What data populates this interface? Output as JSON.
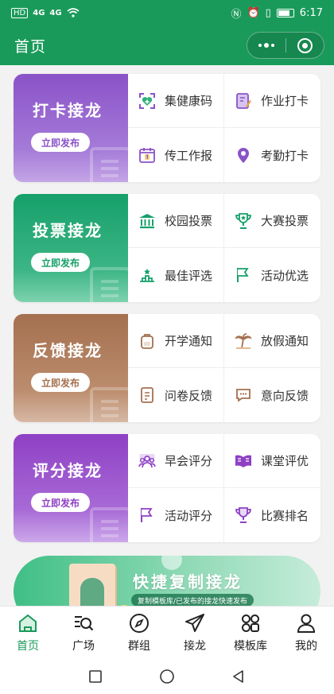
{
  "status_bar": {
    "time": "6:17",
    "sim_labels": [
      "HD",
      "4G",
      "4G"
    ]
  },
  "nav": {
    "title": "首页"
  },
  "cards": [
    {
      "title": "打卡接龙",
      "publish_label": "立即发布",
      "theme": "purple",
      "items": [
        {
          "label": "集健康码",
          "icon": "health-code-icon"
        },
        {
          "label": "作业打卡",
          "icon": "homework-icon"
        },
        {
          "label": "传工作报",
          "icon": "calendar-report-icon"
        },
        {
          "label": "考勤打卡",
          "icon": "location-pin-icon"
        }
      ]
    },
    {
      "title": "投票接龙",
      "publish_label": "立即发布",
      "theme": "green",
      "items": [
        {
          "label": "校园投票",
          "icon": "school-building-icon"
        },
        {
          "label": "大赛投票",
          "icon": "trophy-icon"
        },
        {
          "label": "最佳评选",
          "icon": "podium-icon"
        },
        {
          "label": "活动优选",
          "icon": "flag-icon"
        }
      ]
    },
    {
      "title": "反馈接龙",
      "publish_label": "立即发布",
      "theme": "brown",
      "items": [
        {
          "label": "开学通知",
          "icon": "backpack-icon"
        },
        {
          "label": "放假通知",
          "icon": "palm-tree-icon"
        },
        {
          "label": "问卷反馈",
          "icon": "questionnaire-icon"
        },
        {
          "label": "意向反馈",
          "icon": "chat-bubble-icon"
        }
      ]
    },
    {
      "title": "评分接龙",
      "publish_label": "立即发布",
      "theme": "violet",
      "items": [
        {
          "label": "早会评分",
          "icon": "group-icon"
        },
        {
          "label": "课堂评优",
          "icon": "open-book-icon"
        },
        {
          "label": "活动评分",
          "icon": "flag-icon"
        },
        {
          "label": "比赛排名",
          "icon": "trophy-icon"
        }
      ]
    }
  ],
  "banner": {
    "title": "快捷复制接龙",
    "subtitle": "复制模板库/已发布的接龙快速发布"
  },
  "tabbar": [
    {
      "label": "首页",
      "icon": "home-icon",
      "active": true
    },
    {
      "label": "广场",
      "icon": "search-list-icon",
      "active": false
    },
    {
      "label": "群组",
      "icon": "compass-icon",
      "active": false
    },
    {
      "label": "接龙",
      "icon": "paper-plane-icon",
      "active": false
    },
    {
      "label": "模板库",
      "icon": "grid-icon",
      "active": false
    },
    {
      "label": "我的",
      "icon": "user-icon",
      "active": false
    }
  ],
  "colors": {
    "primary": "#1a9a5a",
    "purple": "#8a52c8",
    "green": "#16a06a",
    "brown": "#a4704f",
    "violet": "#8e40c4"
  }
}
